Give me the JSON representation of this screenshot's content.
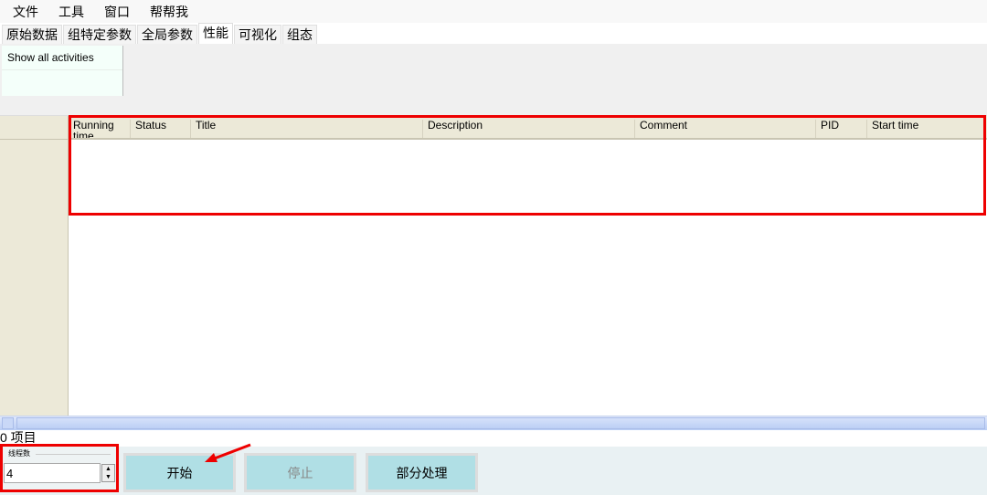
{
  "menu": [
    "文件",
    "工具",
    "窗口",
    "帮帮我"
  ],
  "tabs": [
    "原始数据",
    "组特定参数",
    "全局参数",
    "性能",
    "可视化",
    "组态"
  ],
  "active_tab": "性能",
  "activities": {
    "show_all": "Show all activities"
  },
  "grid": {
    "columns": [
      "Running time",
      "Status",
      "Title",
      "Description",
      "Comment",
      "PID",
      "Start time"
    ],
    "rows": []
  },
  "status": "0 项目",
  "threads": {
    "label": "线程数",
    "value": "4"
  },
  "buttons": {
    "start": "开始",
    "stop": "停止",
    "partial": "部分处理"
  },
  "annotation_color": "#ee0000"
}
